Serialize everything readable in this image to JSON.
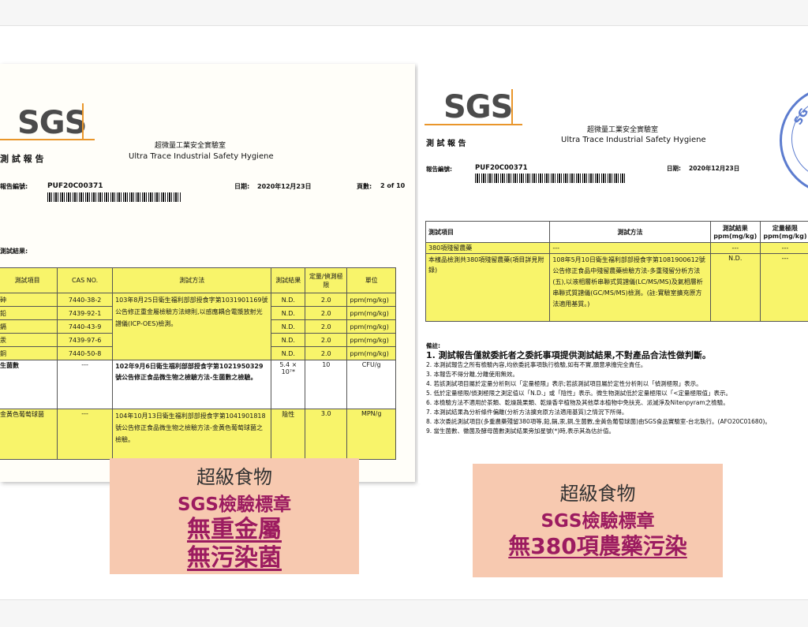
{
  "report_left": {
    "logo": "SGS",
    "lab_name_zh": "超微量工業安全實驗室",
    "lab_name_en": "Ultra Trace Industrial Safety Hygiene",
    "doc_title": "測 試 報 告",
    "report_no_label": "報告編號:",
    "report_no": "PUF20C00371",
    "date_label": "日期:",
    "date": "2020年12月23日",
    "page_label": "頁數:",
    "page": "2 of 10",
    "results_label": "測試結果:",
    "headers": [
      "測試項目",
      "CAS NO.",
      "測試方法",
      "測試結果",
      "定量/偵測極限",
      "單位"
    ],
    "metals": [
      {
        "item": "砷",
        "cas": "7440-38-2",
        "result": "N.D.",
        "limit": "2.0",
        "unit": "ppm(mg/kg)"
      },
      {
        "item": "鉛",
        "cas": "7439-92-1",
        "result": "N.D.",
        "limit": "2.0",
        "unit": "ppm(mg/kg)"
      },
      {
        "item": "鎘",
        "cas": "7440-43-9",
        "result": "N.D.",
        "limit": "2.0",
        "unit": "ppm(mg/kg)"
      },
      {
        "item": "汞",
        "cas": "7439-97-6",
        "result": "N.D.",
        "limit": "2.0",
        "unit": "ppm(mg/kg)"
      },
      {
        "item": "銅",
        "cas": "7440-50-8",
        "result": "N.D.",
        "limit": "2.0",
        "unit": "ppm(mg/kg)"
      }
    ],
    "metals_method": "103年8月25日衛生福利部部授食字第1031901169號公告修正重金屬檢驗方法總則,以感應耦合電漿放射光譜儀(ICP-OES)檢測。",
    "bacteria": {
      "item": "生菌數",
      "cas": "---",
      "method": "102年9月6日衛生福利部部授食字第1021950329號公告修正食品微生物之檢驗方法-生菌數之檢驗。",
      "result": "5.4 × 10⁷*",
      "limit": "10",
      "unit": "CFU/g"
    },
    "staph": {
      "item": "金黃色葡萄球菌",
      "cas": "---",
      "method": "104年10月13日衛生福利部部授食字第1041901818號公告修正食品微生物之檢驗方法-金黃色葡萄球菌之檢驗。",
      "result": "陰性",
      "limit": "3.0",
      "unit": "MPN/g"
    }
  },
  "report_right": {
    "logo": "SGS",
    "lab_name_zh": "超微量工業安全實驗室",
    "lab_name_en": "Ultra Trace Industrial Safety Hygiene",
    "doc_title": "測 試 報 告",
    "report_no_label": "報告編號:",
    "report_no": "PUF20C00371",
    "date_label": "日期:",
    "date": "2020年12月23日",
    "stamp_text": "SG",
    "headers": [
      "測試項目",
      "測試方法",
      "測試結果 ppm(mg/kg)",
      "定量極限 ppm(mg/kg)"
    ],
    "row_group": {
      "item": "380項殘留農藥",
      "method": "---",
      "result": "---",
      "limit": "---"
    },
    "row_main": {
      "item": "本樣品檢測共380項殘留農藥(項目詳見附錄)",
      "method": "108年5月10日衛生福利部部授食字第1081900612號公告修正食品中殘留農藥檢驗方法-多重殘留分析方法(五),以液相層析串聯式質譜儀(LC/MS/MS)及氣相層析串聯式質譜儀(GC/MS/MS)檢測。(註:實驗室擴充原方法適用基質。)",
      "result": "N.D.",
      "limit": "---"
    },
    "notes_label": "備註:",
    "notes": [
      "1. 測試報告僅就委託者之委託事項提供測試結果,不對產品合法性做判斷。",
      "2. 本測試報告之所有檢驗內容,均依委託事項執行檢驗,如有不實,願意承擔完全責任。",
      "3. 本報告不得分離,分離使用無效。",
      "4. 若該測試項目屬於定量分析則以「定量極限」表示;若該測試項目屬於定性分析則以「偵測極限」表示。",
      "5. 低於定量極限/偵測極限之測定值以「N.D.」或「陰性」表示。微生物測試低於定量極限以「<定量極限值」表示。",
      "6. 本檢驗方法不適用於茶類、乾燥蔬果類、乾燥香辛植物及其他草本植物中免扶克、派滅淨及Nitenpyram之檢驗。",
      "7. 本測試結果為分析條件偏離(分析方法擴充原方法適用基質)之情況下所得。",
      "8. 本次委託測試項目(多重農藥殘留380項等,鉛,鎘,汞,銅,生菌數,金黃色葡萄球菌)由SGS食品實驗室-台北執行。(AFO20C01680)。",
      "9. 當生菌數、黴菌及酵母菌數測試結果旁加星號(*)時,表示其為估計值。"
    ]
  },
  "caption_left": {
    "line1": "超級食物",
    "line2": "SGS檢驗標章",
    "line3": "無重金屬",
    "line4": "無污染菌"
  },
  "caption_right": {
    "line1": "超級食物",
    "line2": "SGS檢驗標章",
    "line3": "無380項農藥污染"
  }
}
